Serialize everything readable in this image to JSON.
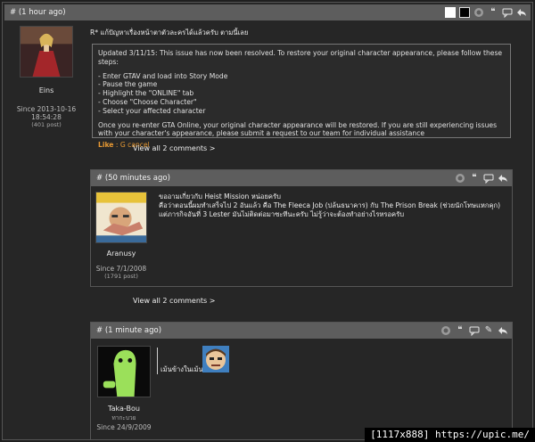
{
  "post1": {
    "header": "# (1 hour ago)",
    "user": {
      "name": "Eins",
      "since": "Since 2013-10-16 18:54:28",
      "posts": "(401 post)"
    },
    "title": "R* แก้ปัญหาเรื่องหน้าตาตัวละครได้แล้วครับ ตามนี้เลย",
    "quote": {
      "l1": "Updated 3/11/15: This issue has now been resolved. To restore your original character appearance, please follow these steps:",
      "l2": "- Enter GTAV and load into Story Mode",
      "l3": "- Pause the game",
      "l4": "- Highlight the \"ONLINE\" tab",
      "l5": "- Choose \"Choose Character\"",
      "l6": "- Select your affected character",
      "l7": "Once you re-enter GTA Online, your original character appearance will be restored. If you are still experiencing issues with your character's appearance, please submit a request to our team for individual assistance",
      "like": "Like",
      "sep": " : ",
      "cancel": "G cancel"
    },
    "view_all": "View all 2 comments >"
  },
  "post2": {
    "header": "# (50 minutes ago)",
    "user": {
      "name": "Aranusy",
      "since": "Since 7/1/2008",
      "posts": "(1791 post)"
    },
    "l1": "ขออามเกี่ยวกับ Heist Mission หน่อยครับ",
    "l2": "คือว่าตอนนี้ผมทำเสร็จไป 2 อันแล้ว คือ The Fleeca Job (ปล้นธนาคาร) กับ The Prison Break (ช่วยนักโทษแหกคุก)",
    "l3": "แต่ภารกิจอันที่ 3 Lester มันไม่ติดต่อมาซะทีนะครับ ไม่รู้ว่าจะต้องทำอย่างไรหรอครับ",
    "view_all": "View all 2 comments >"
  },
  "post3": {
    "header": "# (1 minute ago)",
    "user": {
      "name": "Taka-Bou",
      "subtitle": "ทากะบวย",
      "since": "Since 24/9/2009"
    },
    "text": "เม้นข้างในเม้น"
  },
  "footer": "[1117x888] https://upic.me/",
  "colors": {
    "header_bg": "#5d5d5d",
    "page_bg": "#262626",
    "link_orange": "#e89a33"
  }
}
